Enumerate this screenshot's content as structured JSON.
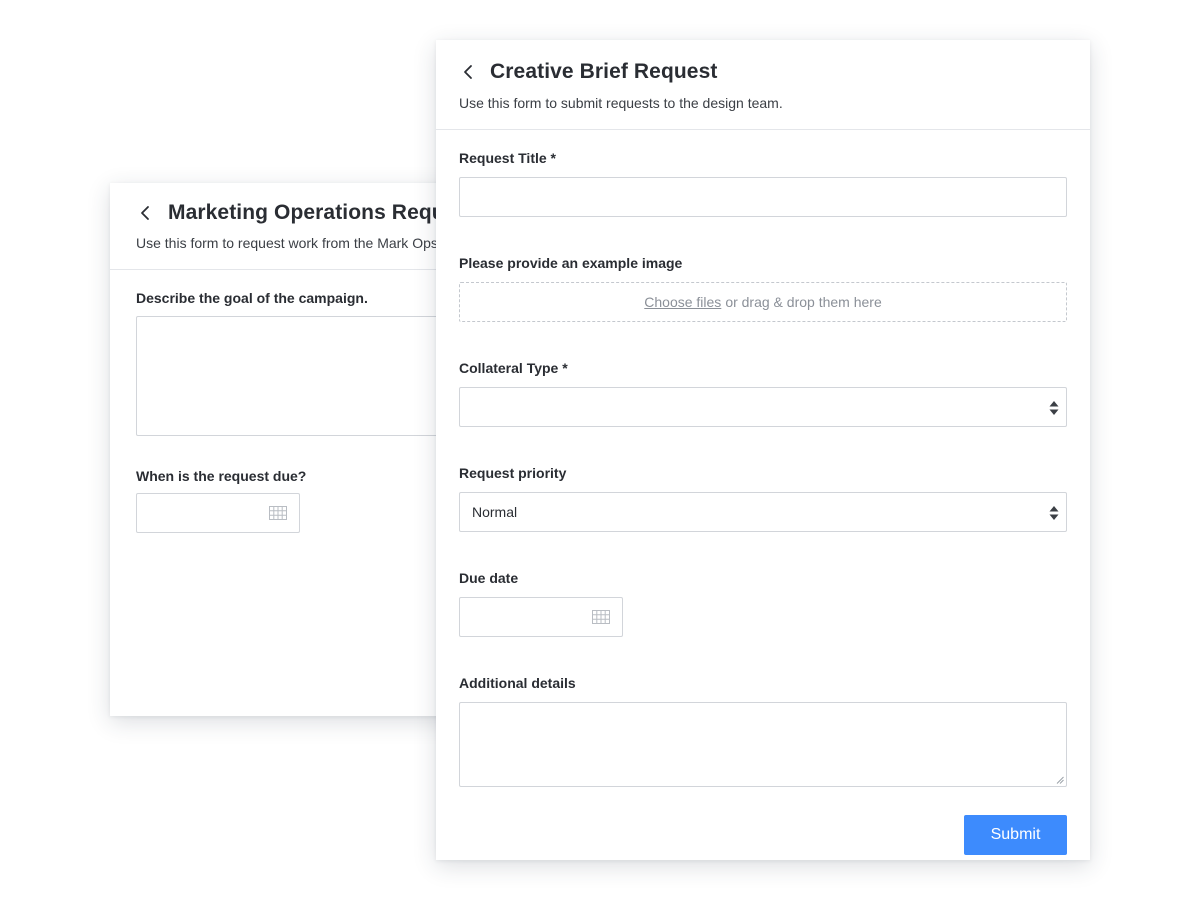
{
  "back_form": {
    "title": "Marketing Operations Request",
    "subtitle": "Use this form to request work from the Mark Ops team.",
    "fields": {
      "goal_label": "Describe the goal of the campaign.",
      "due_label": "When is the request due?"
    }
  },
  "front_form": {
    "title": "Creative Brief Request",
    "subtitle": "Use this form to submit requests to the design team.",
    "fields": {
      "request_title": {
        "label": "Request Title *",
        "value": ""
      },
      "example_image": {
        "label": "Please provide an example image",
        "choose_link": "Choose files",
        "drop_text": "or drag & drop them here"
      },
      "collateral_type": {
        "label": "Collateral Type *",
        "selected": ""
      },
      "request_priority": {
        "label": "Request priority",
        "selected": "Normal"
      },
      "due_date": {
        "label": "Due date",
        "value": ""
      },
      "additional_details": {
        "label": "Additional details",
        "value": ""
      }
    },
    "submit_label": "Submit"
  },
  "colors": {
    "accent": "#3d8bfd",
    "border": "#d2d5da",
    "text": "#2a2d33"
  },
  "icons": [
    "back-chevron-icon",
    "calendar-icon",
    "sort-arrows-icon",
    "resize-handle-icon"
  ]
}
